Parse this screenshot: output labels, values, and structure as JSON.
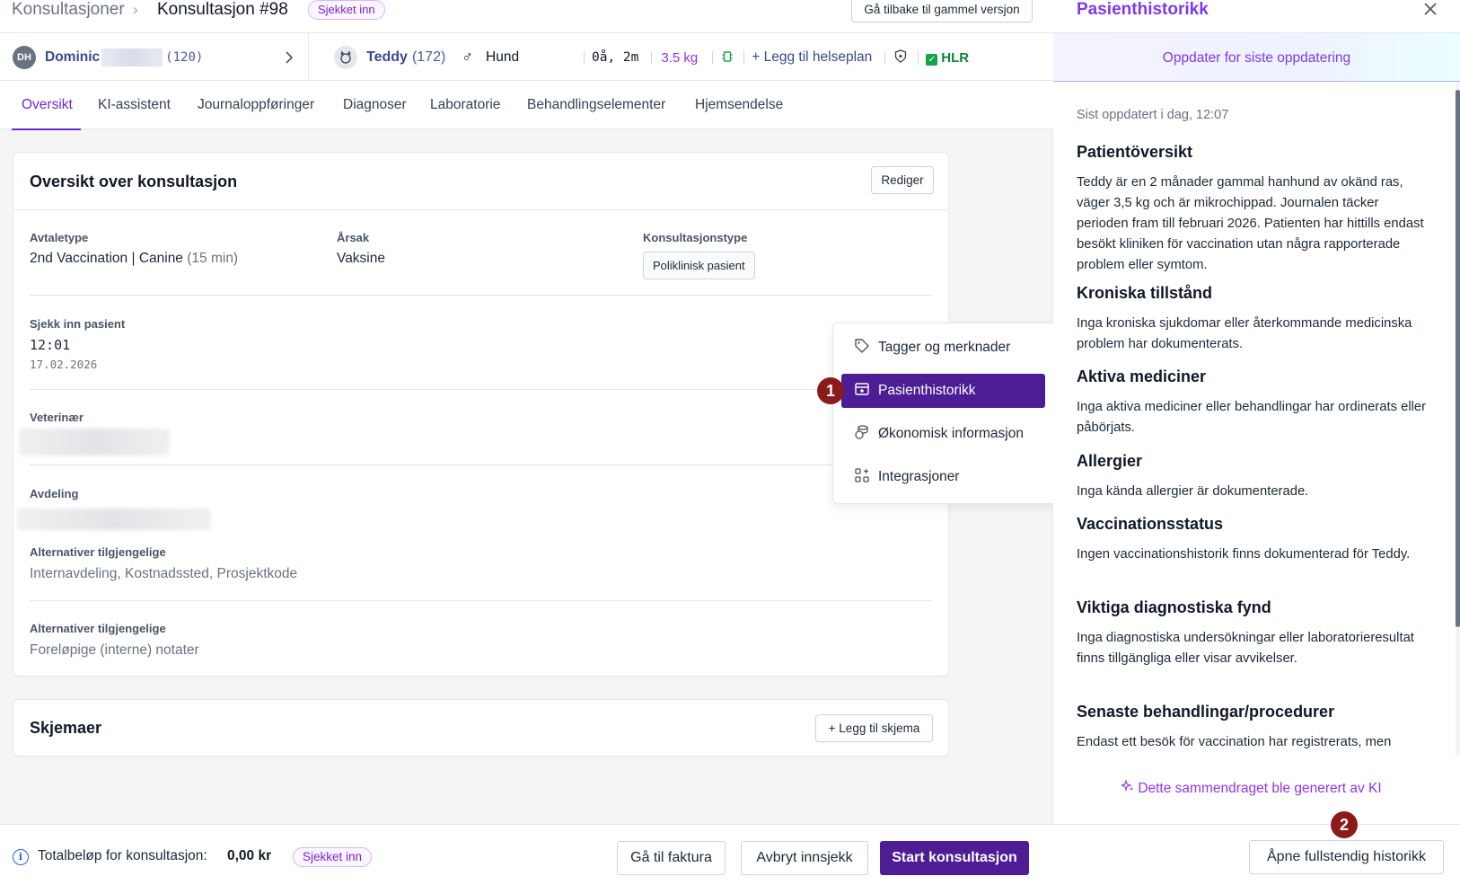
{
  "breadcrumb": {
    "parent": "Konsultasjoner",
    "separator": "›",
    "current": "Konsultasjon #98",
    "status": "Sjekket inn"
  },
  "back_button": "Gå tilbake til gammel versjon",
  "owner": {
    "initials": "DH",
    "name": "Dominic",
    "id": "(120)"
  },
  "pet": {
    "name": "Teddy",
    "id": "(172)",
    "sex_symbol": "♂",
    "species": "Hund",
    "age": "0å, 2m",
    "weight": "3.5 kg",
    "add_plan": "Legg til helseplan",
    "hlr": "HLR"
  },
  "tabs": [
    "Oversikt",
    "KI-assistent",
    "Journaloppføringer",
    "Diagnoser",
    "Laboratorie",
    "Behandlingselementer",
    "Hjemsendelse"
  ],
  "overview": {
    "title": "Oversikt over konsultasjon",
    "edit": "Rediger",
    "appointment_type_label": "Avtaletype",
    "appointment_type_main": "2nd Vaccination",
    "appointment_type_sep": "|",
    "appointment_type_species": "Canine",
    "appointment_type_duration": "(15 min)",
    "reason_label": "Årsak",
    "reason": "Vaksine",
    "consult_type_label": "Konsultasjonstype",
    "consult_type": "Poliklinisk pasient",
    "checkin_label": "Sjekk inn pasient",
    "checkin_time": "12:01",
    "checkin_date": "17.02.2026",
    "vet_label": "Veterinær",
    "dept_label": "Avdeling",
    "alt1_label": "Alternativer tilgjengelige",
    "alt1_value": "Internavdeling, Kostnadssted, Prosjektkode",
    "alt2_label": "Alternativer tilgjengelige",
    "alt2_value": "Foreløpige (interne) notater"
  },
  "forms": {
    "title": "Skjemaer",
    "add": "Legg til skjema"
  },
  "menu": {
    "items": [
      {
        "label": "Tagger og merknader",
        "icon": "tag-icon"
      },
      {
        "label": "Pasienthistorikk",
        "icon": "history-icon",
        "active": true
      },
      {
        "label": "Økonomisk informasjon",
        "icon": "coins-icon"
      },
      {
        "label": "Integrasjoner",
        "icon": "integrations-icon"
      }
    ]
  },
  "badges": {
    "one": "1",
    "two": "2"
  },
  "footer": {
    "total_label": "Totalbeløp for konsultasjon:",
    "total_value": "0,00 kr",
    "status": "Sjekket inn",
    "invoice": "Gå til faktura",
    "cancel": "Avbryt innsjekk",
    "start": "Start konsultasjon"
  },
  "panel": {
    "title": "Pasienthistorikk",
    "refresh": "Oppdater for siste oppdatering",
    "updated": "Sist oppdatert i dag, 12:07",
    "sections": [
      {
        "heading": "Patientöversikt",
        "text": "Teddy är en 2 månader gammal hanhund av okänd ras, väger 3,5 kg och är mikrochippad. Journalen täcker perioden fram till februari 2026. Patienten har hittills endast besökt kliniken för vaccination utan några rapporterade problem eller symtom."
      },
      {
        "heading": "Kroniska tillstånd",
        "text": "Inga kroniska sjukdomar eller återkommande medicinska problem har dokumenterats."
      },
      {
        "heading": "Aktiva mediciner",
        "text": "Inga aktiva mediciner eller behandlingar har ordinerats eller påbörjats."
      },
      {
        "heading": "Allergier",
        "text": "Inga kända allergier är dokumenterade."
      },
      {
        "heading": "Vaccinationsstatus",
        "text": "Ingen vaccinationshistorik finns dokumenterad för Teddy."
      },
      {
        "heading": "Viktiga diagnostiska fynd",
        "text": "Inga diagnostiska undersökningar eller laboratorieresultat finns tillgängliga eller visar avvikelser."
      },
      {
        "heading": "Senaste behandlingar/procedurer",
        "text": "Endast ett besök för vaccination har registrerats, men"
      }
    ],
    "ai_note": "Dette sammendraget ble generert av KI",
    "open_full": "Åpne fullstendig historikk"
  },
  "colors": {
    "accent": "#4c1d95",
    "link": "#3b4a8a",
    "success": "#16a34a",
    "badge": "#8b1a1a"
  }
}
